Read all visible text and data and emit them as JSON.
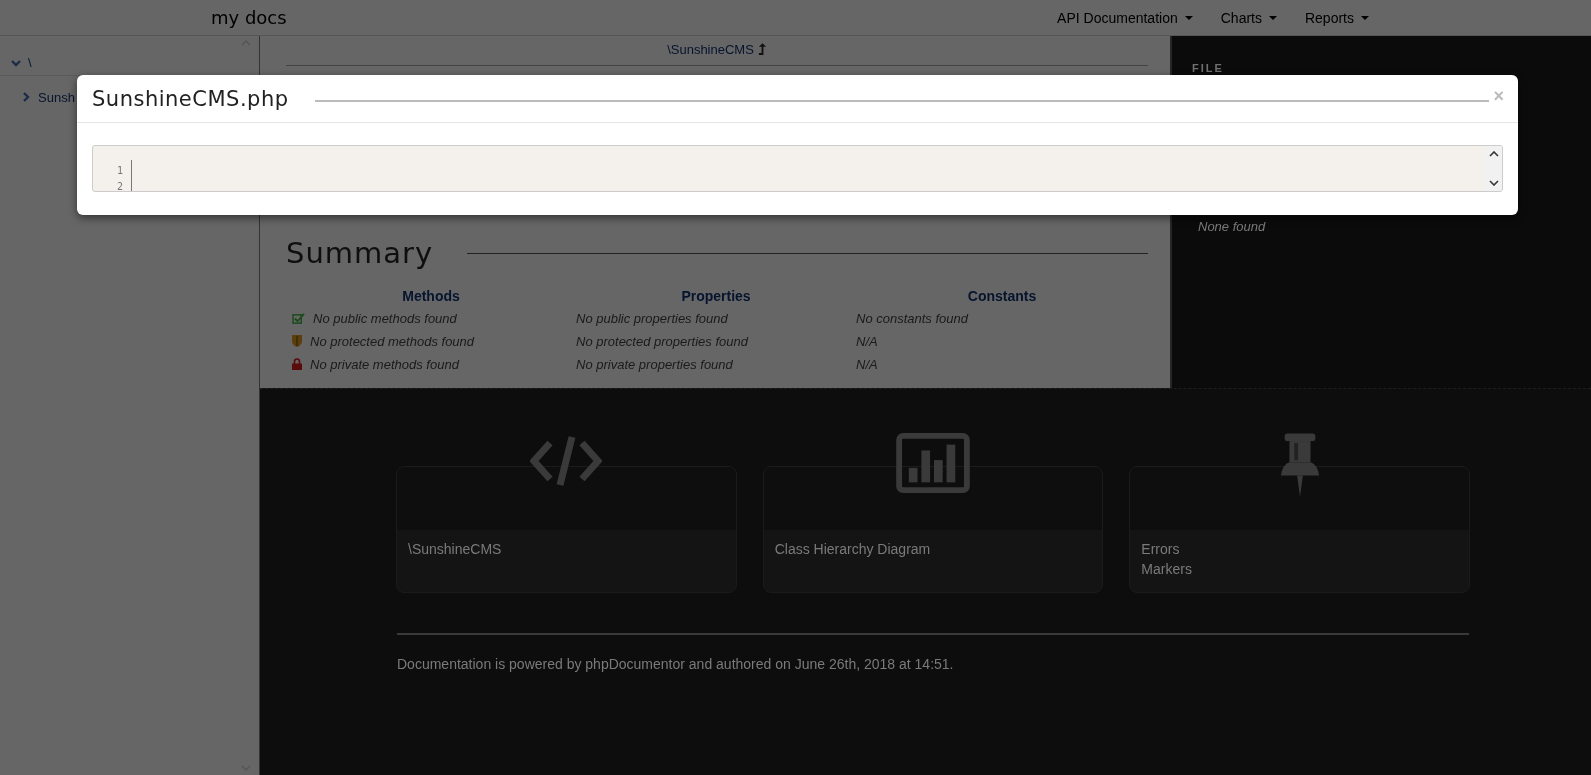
{
  "navbar": {
    "brand": "my docs",
    "menus": [
      {
        "label": "API Documentation"
      },
      {
        "label": "Charts"
      },
      {
        "label": "Reports"
      }
    ]
  },
  "sidebar": {
    "tree": [
      {
        "label": "\\",
        "expanded": true,
        "children": [
          {
            "label": "Sunsh",
            "expanded": false
          }
        ]
      }
    ]
  },
  "content": {
    "namespace_link": "\\SunshineCMS",
    "summary": {
      "title": "Summary",
      "columns": [
        "Methods",
        "Properties",
        "Constants"
      ],
      "rows": [
        {
          "kind": "public",
          "cells": [
            "No public methods found",
            "No public properties found",
            "No constants found"
          ]
        },
        {
          "kind": "protected",
          "cells": [
            "No protected methods found",
            "No protected properties found",
            "N/A"
          ]
        },
        {
          "kind": "private",
          "cells": [
            "No private methods found",
            "No private properties found",
            "N/A"
          ]
        }
      ]
    }
  },
  "side_panel": {
    "heading": "FILE",
    "note": "None found"
  },
  "cards": [
    {
      "kind": "code",
      "lines": [
        "\\SunshineCMS"
      ]
    },
    {
      "kind": "chart",
      "lines": [
        "Class Hierarchy Diagram"
      ]
    },
    {
      "kind": "pin",
      "lines": [
        "Errors",
        "Markers"
      ]
    }
  ],
  "footer": {
    "text": "Documentation is powered by phpDocumentor and authored on June 26th, 2018 at 14:51."
  },
  "modal": {
    "title": "SunshineCMS.php",
    "close": "×",
    "line_numbers": [
      "1",
      "2"
    ]
  }
}
